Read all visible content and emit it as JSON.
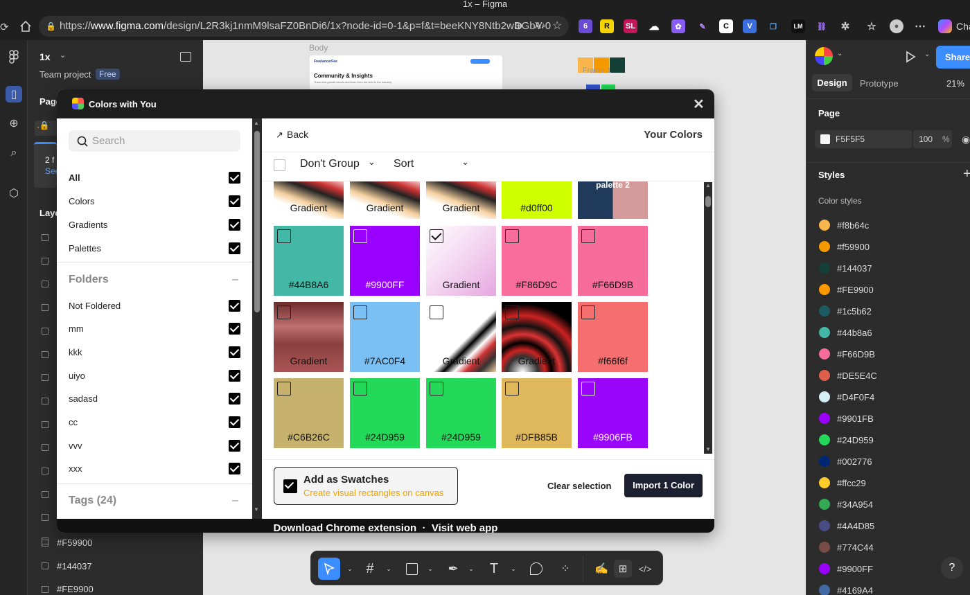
{
  "browser": {
    "window_title": "1x – Figma",
    "url_prefix": "https://",
    "url_host": "www.figma.com",
    "url_path": "/design/L2R3kj1nmM9lsaFZ0BnDi6/1x?node-id=0-1&p=f&t=beeKNY8Ntb2wDGbV-0",
    "extension_badge": "6",
    "profile_label": "Cha"
  },
  "figma_left": {
    "file_name": "1x",
    "team": "Team project",
    "plan_badge": "Free",
    "pages_label": "Page",
    "layers_label": "Laye",
    "partial_text_1": "2 f",
    "partial_text_2": "See",
    "layers": [
      "#F59900",
      "#144037",
      "#FE9900"
    ]
  },
  "canvas": {
    "frame_label_body": "Body",
    "frame_label_frame": "Frame 1",
    "preview_brand": "FreelancerFee",
    "preview_heading": "Community & Insights",
    "preview_sub": "Track new growth trends and learn from the best in the industry."
  },
  "figma_right": {
    "tab_design": "Design",
    "tab_prototype": "Prototype",
    "zoom": "21%",
    "share": "Share",
    "page_section": "Page",
    "page_color": "F5F5F5",
    "page_opacity": "100",
    "page_pct": "%",
    "styles_title": "Styles",
    "color_styles_title": "Color styles",
    "color_styles": [
      {
        "name": "#f8b64c",
        "color": "#f8b64c"
      },
      {
        "name": "#f59900",
        "color": "#f59900"
      },
      {
        "name": "#144037",
        "color": "#144037"
      },
      {
        "name": "#FE9900",
        "color": "#FE9900"
      },
      {
        "name": "#1c5b62",
        "color": "#1c5b62"
      },
      {
        "name": "#44b8a6",
        "color": "#44b8a6"
      },
      {
        "name": "#F66D9B",
        "color": "#F66D9B"
      },
      {
        "name": "#DE5E4C",
        "color": "#DE5E4C"
      },
      {
        "name": "#D4F0F4",
        "color": "#D4F0F4"
      },
      {
        "name": "#9901FB",
        "color": "#9901FB"
      },
      {
        "name": "#24D959",
        "color": "#24D959"
      },
      {
        "name": "#002776",
        "color": "#002776"
      },
      {
        "name": "#ffcc29",
        "color": "#ffcc29"
      },
      {
        "name": "#34A954",
        "color": "#34A954"
      },
      {
        "name": "#4A4D85",
        "color": "#4A4D85"
      },
      {
        "name": "#774C44",
        "color": "#774C44"
      },
      {
        "name": "#9900FF",
        "color": "#9900FF"
      },
      {
        "name": "#4169A4",
        "color": "#4169A4"
      }
    ],
    "help": "?"
  },
  "plugin": {
    "title": "Colors with You",
    "search_placeholder": "Search",
    "filters": [
      {
        "label": "All",
        "checked": true
      },
      {
        "label": "Colors",
        "checked": true
      },
      {
        "label": "Gradients",
        "checked": true
      },
      {
        "label": "Palettes",
        "checked": true
      }
    ],
    "folders_title": "Folders",
    "folders_toggle": "–",
    "folders": [
      {
        "label": "Not Foldered",
        "checked": true
      },
      {
        "label": "mm",
        "checked": true
      },
      {
        "label": "kkk",
        "checked": true
      },
      {
        "label": "uiyo",
        "checked": true
      },
      {
        "label": "sadasd",
        "checked": true
      },
      {
        "label": "cc",
        "checked": true
      },
      {
        "label": "vvv",
        "checked": true
      },
      {
        "label": "xxx",
        "checked": true
      }
    ],
    "tags_title": "Tags (24)",
    "tags_toggle": "–",
    "back": "Back",
    "your_colors": "Your Colors",
    "group_select": "Don't Group",
    "sort_select": "Sort",
    "top_row": [
      {
        "label": "Gradient",
        "kind": "gradient"
      },
      {
        "label": "Gradient",
        "kind": "gradient"
      },
      {
        "label": "Gradient",
        "kind": "gradient"
      },
      {
        "label": "#d0ff00",
        "kind": "color",
        "color": "#d0ff00"
      },
      {
        "label": "palette 2",
        "kind": "palette"
      }
    ],
    "swatches": [
      {
        "label": "#44B8A6",
        "color": "#44B8A6",
        "checked": false,
        "kind": "color"
      },
      {
        "label": "#9900FF",
        "color": "#9900FF",
        "checked": false,
        "kind": "color"
      },
      {
        "label": "Gradient",
        "color": "#f3d6f1",
        "checked": true,
        "kind": "gradient-pink"
      },
      {
        "label": "#F86D9C",
        "color": "#F86D9C",
        "checked": false,
        "kind": "color"
      },
      {
        "label": "#F66D9B",
        "color": "#F66D9B",
        "checked": false,
        "kind": "color"
      },
      {
        "label": "Gradient",
        "color": "#a0505a",
        "checked": false,
        "kind": "gradient-brown"
      },
      {
        "label": "#7AC0F4",
        "color": "#7AC0F4",
        "checked": false,
        "kind": "color"
      },
      {
        "label": "Gradient",
        "color": "#ffffff",
        "checked": false,
        "kind": "gradient-corner"
      },
      {
        "label": "Gradient",
        "color": "#111111",
        "checked": false,
        "kind": "gradient-radial"
      },
      {
        "label": "#f66f6f",
        "color": "#f66f6f",
        "checked": false,
        "kind": "color"
      },
      {
        "label": "#C6B26C",
        "color": "#C6B26C",
        "checked": false,
        "kind": "color"
      },
      {
        "label": "#24D959",
        "color": "#24D959",
        "checked": false,
        "kind": "color"
      },
      {
        "label": "#24D959",
        "color": "#24D959",
        "checked": false,
        "kind": "color"
      },
      {
        "label": "#DFB85B",
        "color": "#DFB85B",
        "checked": false,
        "kind": "color"
      },
      {
        "label": "#9906FB",
        "color": "#9906FB",
        "checked": false,
        "kind": "color"
      }
    ],
    "add_swatches_title": "Add as Swatches",
    "add_swatches_sub": "Create visual rectangles on canvas",
    "clear_selection": "Clear selection",
    "import_button": "Import 1 Color",
    "footer_links": "Download Chrome extension  ·  Visit web app"
  }
}
